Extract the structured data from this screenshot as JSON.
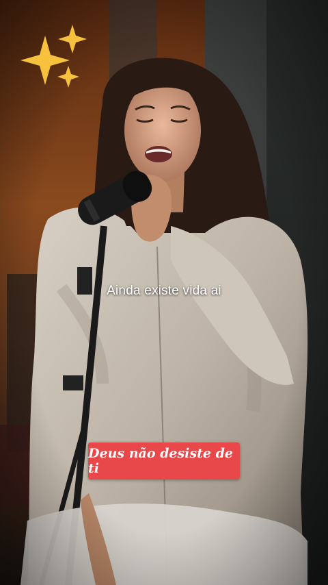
{
  "caption": {
    "text": "Ainda existe vida ai"
  },
  "sticker": {
    "text": "Deus não desiste de ti",
    "background": "#e8484a"
  },
  "emoji": {
    "icon": "sparkles-icon",
    "color": "#f6c23e"
  }
}
